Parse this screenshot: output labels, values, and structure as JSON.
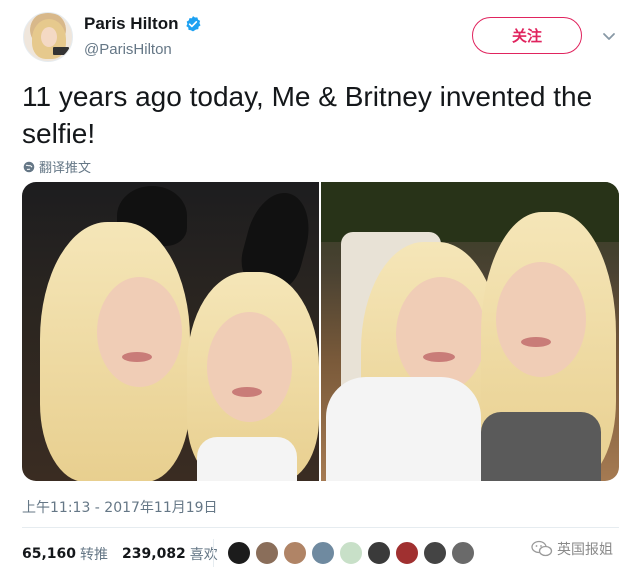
{
  "user": {
    "name": "Paris Hilton",
    "handle": "@ParisHilton",
    "verified": true,
    "avatar_icon": "profile-photo"
  },
  "actions": {
    "follow_label": "关注",
    "caret_icon": "chevron-down-icon"
  },
  "tweet": {
    "text": "11 years ago today, Me & Britney invented the selfie!",
    "translate_label": "翻译推文",
    "translate_icon": "globe-icon",
    "timestamp": "上午11:13 - 2017年11月19日"
  },
  "stats": {
    "retweets_count": "65,160",
    "retweets_label": "转推",
    "likes_count": "239,082",
    "likes_label": "喜欢"
  },
  "likers": [
    {
      "color": "#1c1c1c"
    },
    {
      "color": "#8a6e5a"
    },
    {
      "color": "#b08466"
    },
    {
      "color": "#6f8aa0"
    },
    {
      "color": "#c8e0c8"
    },
    {
      "color": "#3a3a3a"
    },
    {
      "color": "#a03030"
    },
    {
      "color": "#444444"
    },
    {
      "color": "#6a6a6a"
    }
  ],
  "watermark": {
    "text": "英国报姐",
    "icon": "wechat-icon"
  },
  "colors": {
    "accent": "#e0245e",
    "verified_blue": "#1da1f2",
    "muted_text": "#657786"
  }
}
